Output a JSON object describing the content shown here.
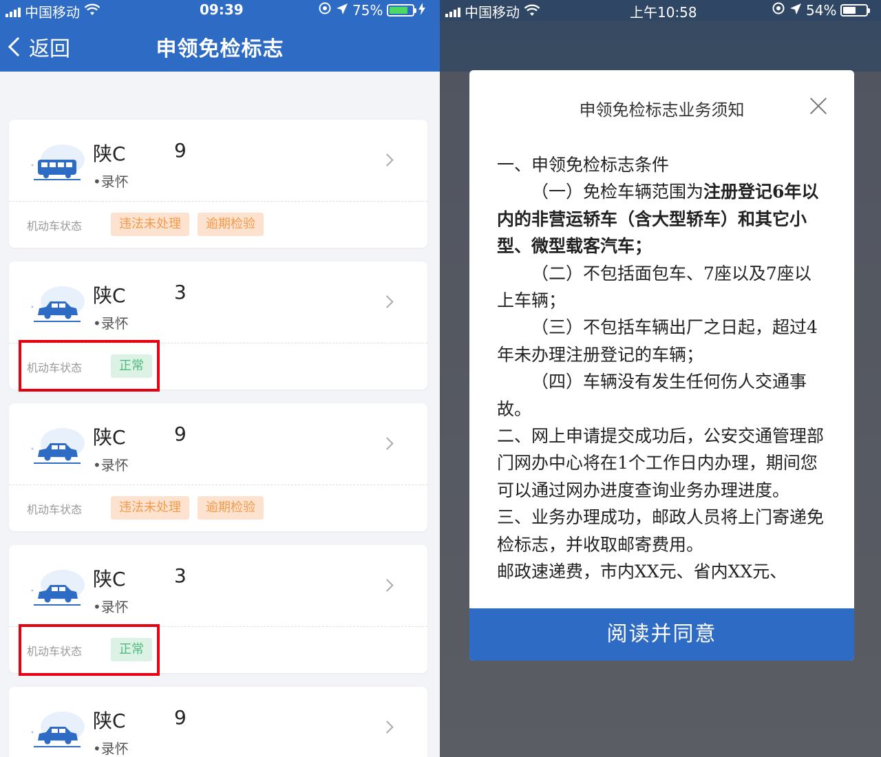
{
  "left": {
    "status": {
      "carrier": "中国移动",
      "time": "09:39",
      "battery": "75%",
      "battery_level": 0.75
    },
    "nav": {
      "back_label": "返回",
      "title": "申领免检标志"
    },
    "status_label": "机动车状态",
    "vehicles": [
      {
        "plate_start": "陕C",
        "plate_end": "9",
        "owner": "•录怀",
        "tags": [
          {
            "text": "违法未处理",
            "kind": "warn"
          },
          {
            "text": "逾期检验",
            "kind": "warn"
          }
        ]
      },
      {
        "plate_start": "陕C",
        "plate_end": "3",
        "owner": "•录怀",
        "tags": [
          {
            "text": "正常",
            "kind": "ok"
          }
        ]
      },
      {
        "plate_start": "陕C",
        "plate_end": "9",
        "owner": "•录怀",
        "tags": [
          {
            "text": "违法未处理",
            "kind": "warn"
          },
          {
            "text": "逾期检验",
            "kind": "warn"
          }
        ]
      },
      {
        "plate_start": "陕C",
        "plate_end": "3",
        "owner": "•录怀",
        "tags": [
          {
            "text": "正常",
            "kind": "ok"
          }
        ]
      },
      {
        "plate_start": "陕C",
        "plate_end": "9",
        "owner": "•录怀",
        "tags": []
      }
    ]
  },
  "right": {
    "status": {
      "carrier": "中国移动",
      "time": "上午10:58",
      "battery": "54%",
      "battery_level": 0.54
    },
    "modal": {
      "title": "申领免检标志业务须知",
      "section1_heading": "一、申领免检标志条件",
      "item1_prefix": "（一）免检车辆范围为",
      "item1_bold": "注册登记6年以内的非营运轿车（含大型轿车）和其它小型、微型载客汽车；",
      "item2": "（二）不包括面包车、7座以及7座以上车辆；",
      "item3": "（三）不包括车辆出厂之日起，超过4年未办理注册登记的车辆；",
      "item4": "（四）车辆没有发生任何伤人交通事故。",
      "section2": "二、网上申请提交成功后，公安交通管理部门网办中心将在1个工作日内办理，期间您可以通过网办进度查询业务办理进度。",
      "section3": "三、业务办理成功，邮政人员将上门寄递免检标志，并收取邮寄费用。",
      "postage": "邮政速递费，市内XX元、省内XX元、",
      "agree_label": "阅读并同意"
    }
  },
  "colors": {
    "primary": "#2e6bc4",
    "warn_bg": "#fde3cf",
    "warn_text": "#f39a4b",
    "ok_bg": "#dcf2e5",
    "ok_text": "#4fb97f",
    "highlight": "#e60012"
  }
}
